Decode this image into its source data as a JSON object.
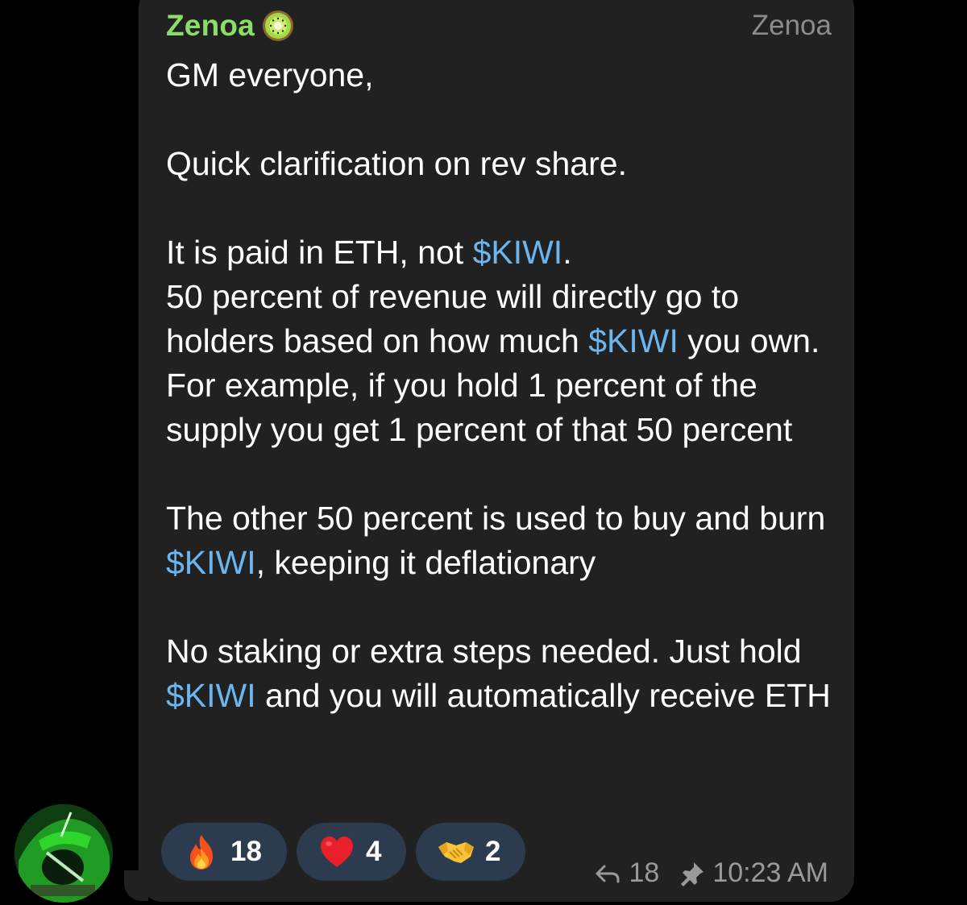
{
  "sender": {
    "name": "Zenoa",
    "badge_icon": "kiwi-icon",
    "admin_title": "Zenoa",
    "name_color": "#8bdc6b"
  },
  "message": {
    "greeting": "GM everyone,",
    "line1": "Quick clarification on rev share.",
    "p2_a": "It is paid in ETH, not ",
    "p2_ticker": "$KIWI",
    "p2_b": ".",
    "p3_a": "50 percent of revenue will directly go to holders based on how much ",
    "p3_ticker": "$KIWI",
    "p3_b": " you own. For example, if you hold 1 percent of the supply you get 1 percent of that 50 percent",
    "p4_a": "The other 50 percent is used to buy and burn ",
    "p4_ticker": "$KIWI",
    "p4_b": ", keeping it deflationary",
    "p5_a": "No staking or extra steps needed. Just hold ",
    "p5_ticker": "$KIWI",
    "p5_b": " and you will automatically receive ETH",
    "ticker_color": "#6cb6f0"
  },
  "reactions": [
    {
      "icon": "fire-emoji-icon",
      "count": "18"
    },
    {
      "icon": "heart-emoji-icon",
      "count": "4"
    },
    {
      "icon": "handshake-emoji-icon",
      "count": "2"
    }
  ],
  "meta": {
    "reply_icon": "reply-arrow-icon",
    "reply_count": "18",
    "pin_icon": "pin-icon",
    "time": "10:23 AM"
  },
  "colors": {
    "bubble": "#212121",
    "background": "#000000",
    "reaction_pill": "#2d3b4e"
  }
}
